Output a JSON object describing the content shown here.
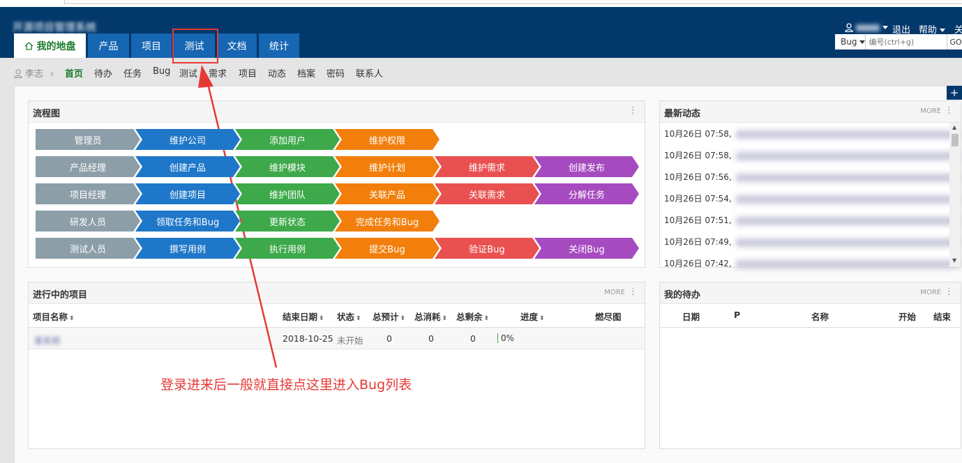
{
  "header": {
    "site_title": "开源项目管理系统",
    "logout": "退出",
    "help": "帮助",
    "lang": "关",
    "tabs": [
      "我的地盘",
      "产品",
      "项目",
      "测试",
      "文档",
      "统计"
    ],
    "search_type": "Bug",
    "search_placeholder": "编号(ctrl+g)",
    "search_go": "GO"
  },
  "subnav": {
    "user": "李志",
    "items": [
      "首页",
      "待办",
      "任务",
      "Bug",
      "测试",
      "需求",
      "项目",
      "动态",
      "档案",
      "密码",
      "联系人"
    ]
  },
  "flowchart": {
    "title": "流程图",
    "rows": [
      [
        "管理员",
        "维护公司",
        "添加用户",
        "维护权限"
      ],
      [
        "产品经理",
        "创建产品",
        "维护模块",
        "维护计划",
        "维护需求",
        "创建发布"
      ],
      [
        "项目经理",
        "创建项目",
        "维护团队",
        "关联产品",
        "关联需求",
        "分解任务"
      ],
      [
        "研发人员",
        "领取任务和Bug",
        "更新状态",
        "完成任务和Bug"
      ],
      [
        "测试人员",
        "撰写用例",
        "执行用例",
        "提交Bug",
        "验证Bug",
        "关闭Bug"
      ]
    ],
    "colors": [
      "#8c9ea8",
      "#1f77c9",
      "#3da94a",
      "#f27f0c",
      "#e95151",
      "#a64bbf"
    ]
  },
  "feed": {
    "title": "最新动态",
    "more": "MORE",
    "items": [
      "10月26日 07:58,",
      "10月26日 07:58,",
      "10月26日 07:56,",
      "10月26日 07:54,",
      "10月26日 07:51,",
      "10月26日 07:49,",
      "10月26日 07:42,"
    ]
  },
  "projects": {
    "title": "进行中的项目",
    "more": "MORE",
    "columns": [
      "项目名称",
      "结束日期",
      "状态",
      "总预计",
      "总消耗",
      "总剩余",
      "进度",
      "燃尽图"
    ],
    "rows": [
      {
        "name": "某系统",
        "end": "2018-10-25",
        "status": "未开始",
        "est": "0",
        "consumed": "0",
        "left": "0",
        "progress": "0%"
      }
    ]
  },
  "todo": {
    "title": "我的待办",
    "more": "MORE",
    "columns": [
      "日期",
      "P",
      "名称",
      "开始",
      "结束"
    ]
  },
  "annotation": "登录进来后一般就直接点这里进入Bug列表",
  "accent_color": "#e53935"
}
